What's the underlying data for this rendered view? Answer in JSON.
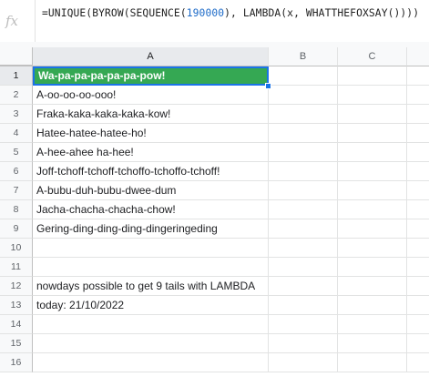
{
  "formula_bar": {
    "fx_label": "fx",
    "formula_prefix": "=UNIQUE(BYROW(SEQUENCE(",
    "formula_number": "190000",
    "formula_suffix": "), LAMBDA(x, WHATTHEFOXSAY())))"
  },
  "columns": [
    "A",
    "B",
    "C"
  ],
  "rows": [
    {
      "num": "1",
      "a": "Wa-pa-pa-pa-pa-pa-pow!"
    },
    {
      "num": "2",
      "a": "A-oo-oo-oo-ooo!"
    },
    {
      "num": "3",
      "a": "Fraka-kaka-kaka-kaka-kow!"
    },
    {
      "num": "4",
      "a": "Hatee-hatee-hatee-ho!"
    },
    {
      "num": "5",
      "a": "A-hee-ahee ha-hee!"
    },
    {
      "num": "6",
      "a": "Joff-tchoff-tchoff-tchoffo-tchoffo-tchoff!"
    },
    {
      "num": "7",
      "a": "A-bubu-duh-bubu-dwee-dum"
    },
    {
      "num": "8",
      "a": "Jacha-chacha-chacha-chow!"
    },
    {
      "num": "9",
      "a": "Gering-ding-ding-ding-dingeringeding"
    },
    {
      "num": "10",
      "a": ""
    },
    {
      "num": "11",
      "a": ""
    },
    {
      "num": "12",
      "a": "nowdays possible to get 9 tails with LAMBDA"
    },
    {
      "num": "13",
      "a": "today: 21/10/2022"
    },
    {
      "num": "14",
      "a": ""
    },
    {
      "num": "15",
      "a": ""
    },
    {
      "num": "16",
      "a": ""
    }
  ],
  "colors": {
    "header_fill": "#35a853",
    "selection_border": "#1a73e8"
  }
}
